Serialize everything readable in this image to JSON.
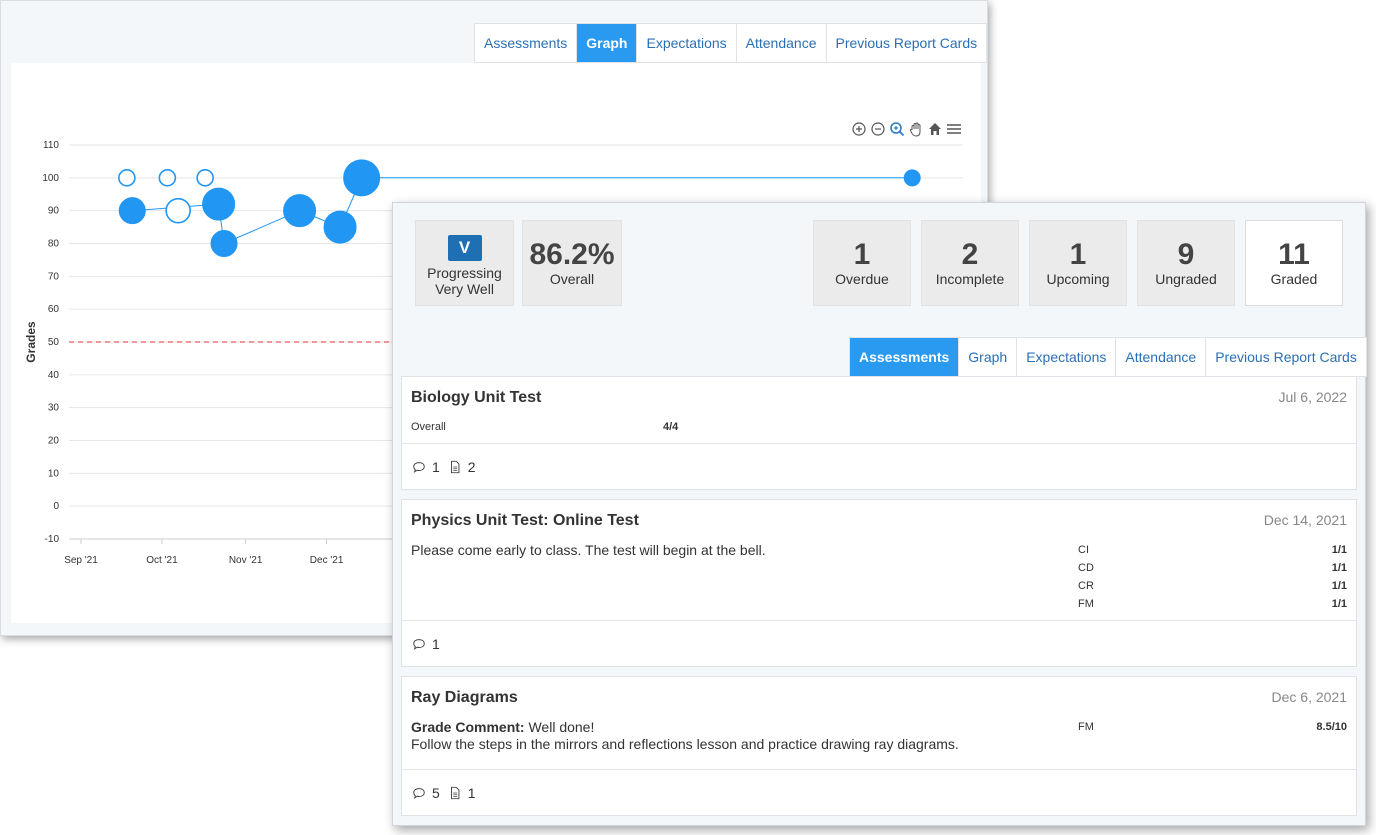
{
  "graph_window": {
    "tabs": [
      "Assessments",
      "Graph",
      "Expectations",
      "Attendance",
      "Previous Report Cards"
    ],
    "active_tab": "Graph",
    "toolbar_icons": [
      "zoom-in-icon",
      "zoom-out-icon",
      "zoom-selection-icon",
      "pan-icon",
      "home-icon",
      "menu-icon"
    ]
  },
  "chart_data": {
    "type": "scatter",
    "ylabel": "Grades",
    "yticks": [
      110,
      100,
      90,
      80,
      70,
      60,
      50,
      40,
      30,
      20,
      10,
      0,
      -10
    ],
    "ylim": [
      -10,
      110
    ],
    "xticks": [
      "Sep '21",
      "Oct '21",
      "Nov '21",
      "Dec '21"
    ],
    "threshold_line": 50,
    "grid": true,
    "colors": {
      "marker": "#2196f3",
      "threshold": "#e0303a"
    },
    "points": [
      {
        "x": "2021-09-18",
        "y": 100,
        "filled": false,
        "size": "small"
      },
      {
        "x": "2021-09-20",
        "y": 90,
        "filled": true,
        "size": "medium"
      },
      {
        "x": "2021-10-03",
        "y": 100,
        "filled": false,
        "size": "small"
      },
      {
        "x": "2021-10-07",
        "y": 90,
        "filled": false,
        "size": "medium"
      },
      {
        "x": "2021-10-17",
        "y": 100,
        "filled": false,
        "size": "small"
      },
      {
        "x": "2021-10-22",
        "y": 92,
        "filled": true,
        "size": "large"
      },
      {
        "x": "2021-10-24",
        "y": 80,
        "filled": true,
        "size": "medium"
      },
      {
        "x": "2021-11-21",
        "y": 90,
        "filled": true,
        "size": "large"
      },
      {
        "x": "2021-12-06",
        "y": 85,
        "filled": true,
        "size": "large"
      },
      {
        "x": "2021-12-14",
        "y": 100,
        "filled": true,
        "size": "xlarge"
      },
      {
        "x": "2022-07-06",
        "y": 100,
        "filled": true,
        "size": "small"
      }
    ]
  },
  "summary": {
    "progress_badge": "V",
    "progress_label_1": "Progressing",
    "progress_label_2": "Very Well",
    "overall_value": "86.2%",
    "overall_label": "Overall",
    "stats": [
      {
        "value": "1",
        "label": "Overdue"
      },
      {
        "value": "2",
        "label": "Incomplete"
      },
      {
        "value": "1",
        "label": "Upcoming"
      },
      {
        "value": "9",
        "label": "Ungraded"
      },
      {
        "value": "11",
        "label": "Graded"
      }
    ]
  },
  "front_tabs": [
    "Assessments",
    "Graph",
    "Expectations",
    "Attendance",
    "Previous Report Cards"
  ],
  "front_active_tab": "Assessments",
  "assessments": [
    {
      "title": "Biology Unit Test",
      "date": "Jul 6, 2022",
      "criteria": [
        {
          "name": "Overall",
          "score": "4/4"
        }
      ],
      "comments": "1",
      "attachments": "2"
    },
    {
      "title": "Physics Unit Test: Online Test",
      "date": "Dec 14, 2021",
      "description": "Please come early to class. The test will begin at the bell.",
      "criteria": [
        {
          "name": "CI",
          "score": "1/1"
        },
        {
          "name": "CD",
          "score": "1/1"
        },
        {
          "name": "CR",
          "score": "1/1"
        },
        {
          "name": "FM",
          "score": "1/1"
        }
      ],
      "comments": "1"
    },
    {
      "title": "Ray Diagrams",
      "date": "Dec 6, 2021",
      "grade_comment_label": "Grade Comment:",
      "grade_comment": " Well done!",
      "description": "Follow the steps in the mirrors and reflections lesson and practice drawing ray diagrams.",
      "criteria": [
        {
          "name": "FM",
          "score": "8.5/10"
        }
      ],
      "comments": "5",
      "attachments": "1"
    }
  ]
}
